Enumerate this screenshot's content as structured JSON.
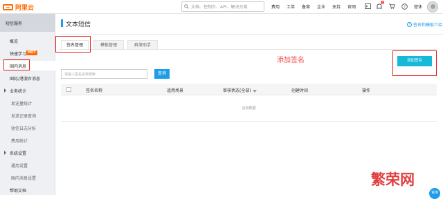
{
  "header": {
    "logo_text": "阿里云",
    "search_placeholder": "文档、控制台、API、解决方案",
    "nav": [
      "费用",
      "工单",
      "备案",
      "企业",
      "支持",
      "官网"
    ],
    "user_name": "楚休",
    "icons": [
      "search-icon",
      "terminal-icon",
      "bell-icon",
      "cart-icon",
      "help-icon",
      "avatar"
    ],
    "notification_count": "1"
  },
  "sidebar": {
    "title": "短信服务",
    "items": [
      {
        "label": "概览",
        "type": "item"
      },
      {
        "label": "快速学习",
        "type": "item",
        "badge": "HOT"
      },
      {
        "label": "国内消息",
        "type": "item",
        "active": true
      },
      {
        "label": "国际/港澳台消息",
        "type": "item"
      },
      {
        "label": "业务统计",
        "type": "group"
      },
      {
        "label": "发送量统计",
        "type": "sub"
      },
      {
        "label": "发送记录查询",
        "type": "sub"
      },
      {
        "label": "短信日志分析",
        "type": "sub"
      },
      {
        "label": "费用统计",
        "type": "sub"
      },
      {
        "label": "系统设置",
        "type": "group"
      },
      {
        "label": "通用设置",
        "type": "sub"
      },
      {
        "label": "国内消息设置",
        "type": "sub"
      },
      {
        "label": "帮助文档",
        "type": "item"
      }
    ]
  },
  "main": {
    "title": "文本短信",
    "help_link": "签名和模板介绍",
    "tabs": [
      {
        "label": "签名管理",
        "active": true
      },
      {
        "label": "模板管理",
        "active": false
      },
      {
        "label": "群发助手",
        "active": false
      }
    ],
    "search_placeholder": "请输入签名名称搜索",
    "query_button": "查询",
    "add_button": "添加签名",
    "annotation": "添加签名",
    "table": {
      "columns": [
        "签名名称",
        "适用场景",
        "审核状态(全部)",
        "创建时间",
        "操作"
      ],
      "empty_text": "没有数据"
    }
  },
  "watermark": "繁荣网",
  "chat_label": "咨询",
  "colors": {
    "accent": "#1e9ce8",
    "brand": "#ff6a00",
    "add_button": "#17b9d8",
    "annotation_red": "#e02020"
  }
}
